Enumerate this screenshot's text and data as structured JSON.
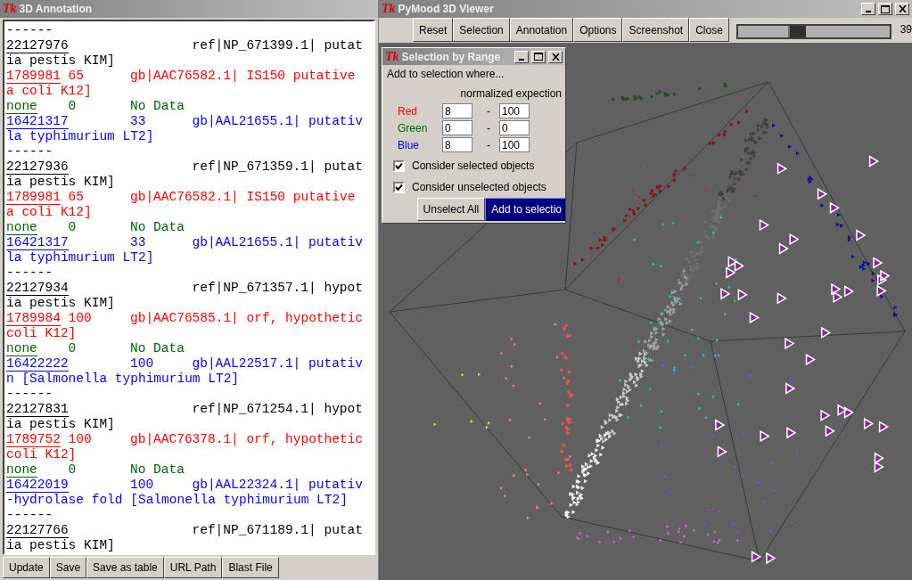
{
  "annotation_window": {
    "logo": "Tk",
    "title": "3D Annotation",
    "lines": [
      {
        "kind": "sep",
        "text": "------"
      },
      {
        "kind": "query",
        "link": "22127976",
        "desc": "ref|NP_671399.1| putat"
      },
      {
        "kind": "query_cont",
        "text": "ia pestis KIM]"
      },
      {
        "kind": "ecoli",
        "link": "1789981",
        "score": "65",
        "desc": "gb|AAC76582.1| IS150 putative"
      },
      {
        "kind": "ecoli_cont",
        "text": "a coli K12]"
      },
      {
        "kind": "none",
        "link": "none",
        "score": "0",
        "desc": "No Data"
      },
      {
        "kind": "salmonella",
        "link": "16421317",
        "score": "33",
        "desc": "gb|AAL21655.1| putativ"
      },
      {
        "kind": "salmonella_cont",
        "text": "la typhimurium LT2]"
      },
      {
        "kind": "sep",
        "text": "------"
      },
      {
        "kind": "query",
        "link": "22127936",
        "desc": "ref|NP_671359.1| putat"
      },
      {
        "kind": "query_cont",
        "text": "ia pestis KIM]"
      },
      {
        "kind": "ecoli",
        "link": "1789981",
        "score": "65",
        "desc": "gb|AAC76582.1| IS150 putative"
      },
      {
        "kind": "ecoli_cont",
        "text": "a coli K12]"
      },
      {
        "kind": "none",
        "link": "none",
        "score": "0",
        "desc": "No Data"
      },
      {
        "kind": "salmonella",
        "link": "16421317",
        "score": "33",
        "desc": "gb|AAL21655.1| putativ"
      },
      {
        "kind": "salmonella_cont",
        "text": "la typhimurium LT2]"
      },
      {
        "kind": "sep",
        "text": "------"
      },
      {
        "kind": "query",
        "link": "22127934",
        "desc": "ref|NP_671357.1| hypot"
      },
      {
        "kind": "query_cont",
        "text": "ia pestis KIM]"
      },
      {
        "kind": "ecoli",
        "link": "1789984",
        "score": "100",
        "desc": "gb|AAC76585.1| orf, hypothetic"
      },
      {
        "kind": "ecoli_cont",
        "text": "coli K12]"
      },
      {
        "kind": "none",
        "link": "none",
        "score": "0",
        "desc": "No Data"
      },
      {
        "kind": "salmonella",
        "link": "16422222",
        "score": "100",
        "desc": "gb|AAL22517.1| putativ"
      },
      {
        "kind": "salmonella_cont",
        "text": "n [Salmonella typhimurium LT2]"
      },
      {
        "kind": "sep",
        "text": "------"
      },
      {
        "kind": "query",
        "link": "22127831",
        "desc": "ref|NP_671254.1| hypot"
      },
      {
        "kind": "query_cont",
        "text": "ia pestis KIM]"
      },
      {
        "kind": "ecoli",
        "link": "1789752",
        "score": "100",
        "desc": "gb|AAC76378.1| orf, hypothetic"
      },
      {
        "kind": "ecoli_cont",
        "text": "coli K12]"
      },
      {
        "kind": "none",
        "link": "none",
        "score": "0",
        "desc": "No Data"
      },
      {
        "kind": "salmonella",
        "link": "16422019",
        "score": "100",
        "desc": "gb|AAL22324.1| putativ"
      },
      {
        "kind": "salmonella_cont",
        "text": "-hydrolase fold [Salmonella typhimurium LT2]"
      },
      {
        "kind": "sep",
        "text": "------"
      },
      {
        "kind": "query",
        "link": "22127766",
        "desc": "ref|NP_671189.1| putat"
      },
      {
        "kind": "query_cont",
        "text": "ia pestis KIM]"
      }
    ],
    "buttons": [
      "Update",
      "Save",
      "Save as table",
      "URL Path",
      "Blast File"
    ]
  },
  "viewer_window": {
    "logo": "Tk",
    "title": "PyMood 3D Viewer",
    "toolbar": [
      "Reset",
      "Selection",
      "Annotation",
      "Options",
      "Screenshot",
      "Close"
    ],
    "slider": {
      "level": 0.39,
      "reading": "39"
    },
    "dialog": {
      "logo": "Tk",
      "title": "Selection by Range",
      "prompt": "Add to selection where...",
      "column_header": "normalized expection",
      "ranges": [
        {
          "label": "Red",
          "color": "#ff0000",
          "min": "8",
          "dash": "-",
          "max": "100"
        },
        {
          "label": "Green",
          "color": "#006400",
          "min": "0",
          "dash": "-",
          "max": "0"
        },
        {
          "label": "Blue",
          "color": "#0000ff",
          "min": "8",
          "dash": "-",
          "max": "100"
        }
      ],
      "checkboxes": [
        {
          "label": "Consider selected objects",
          "checked": true
        },
        {
          "label": "Consider unselected objects",
          "checked": true
        }
      ],
      "buttons": [
        {
          "label": "Unselect All",
          "default": false
        },
        {
          "label": "Add to selectio",
          "default": true
        }
      ]
    }
  }
}
